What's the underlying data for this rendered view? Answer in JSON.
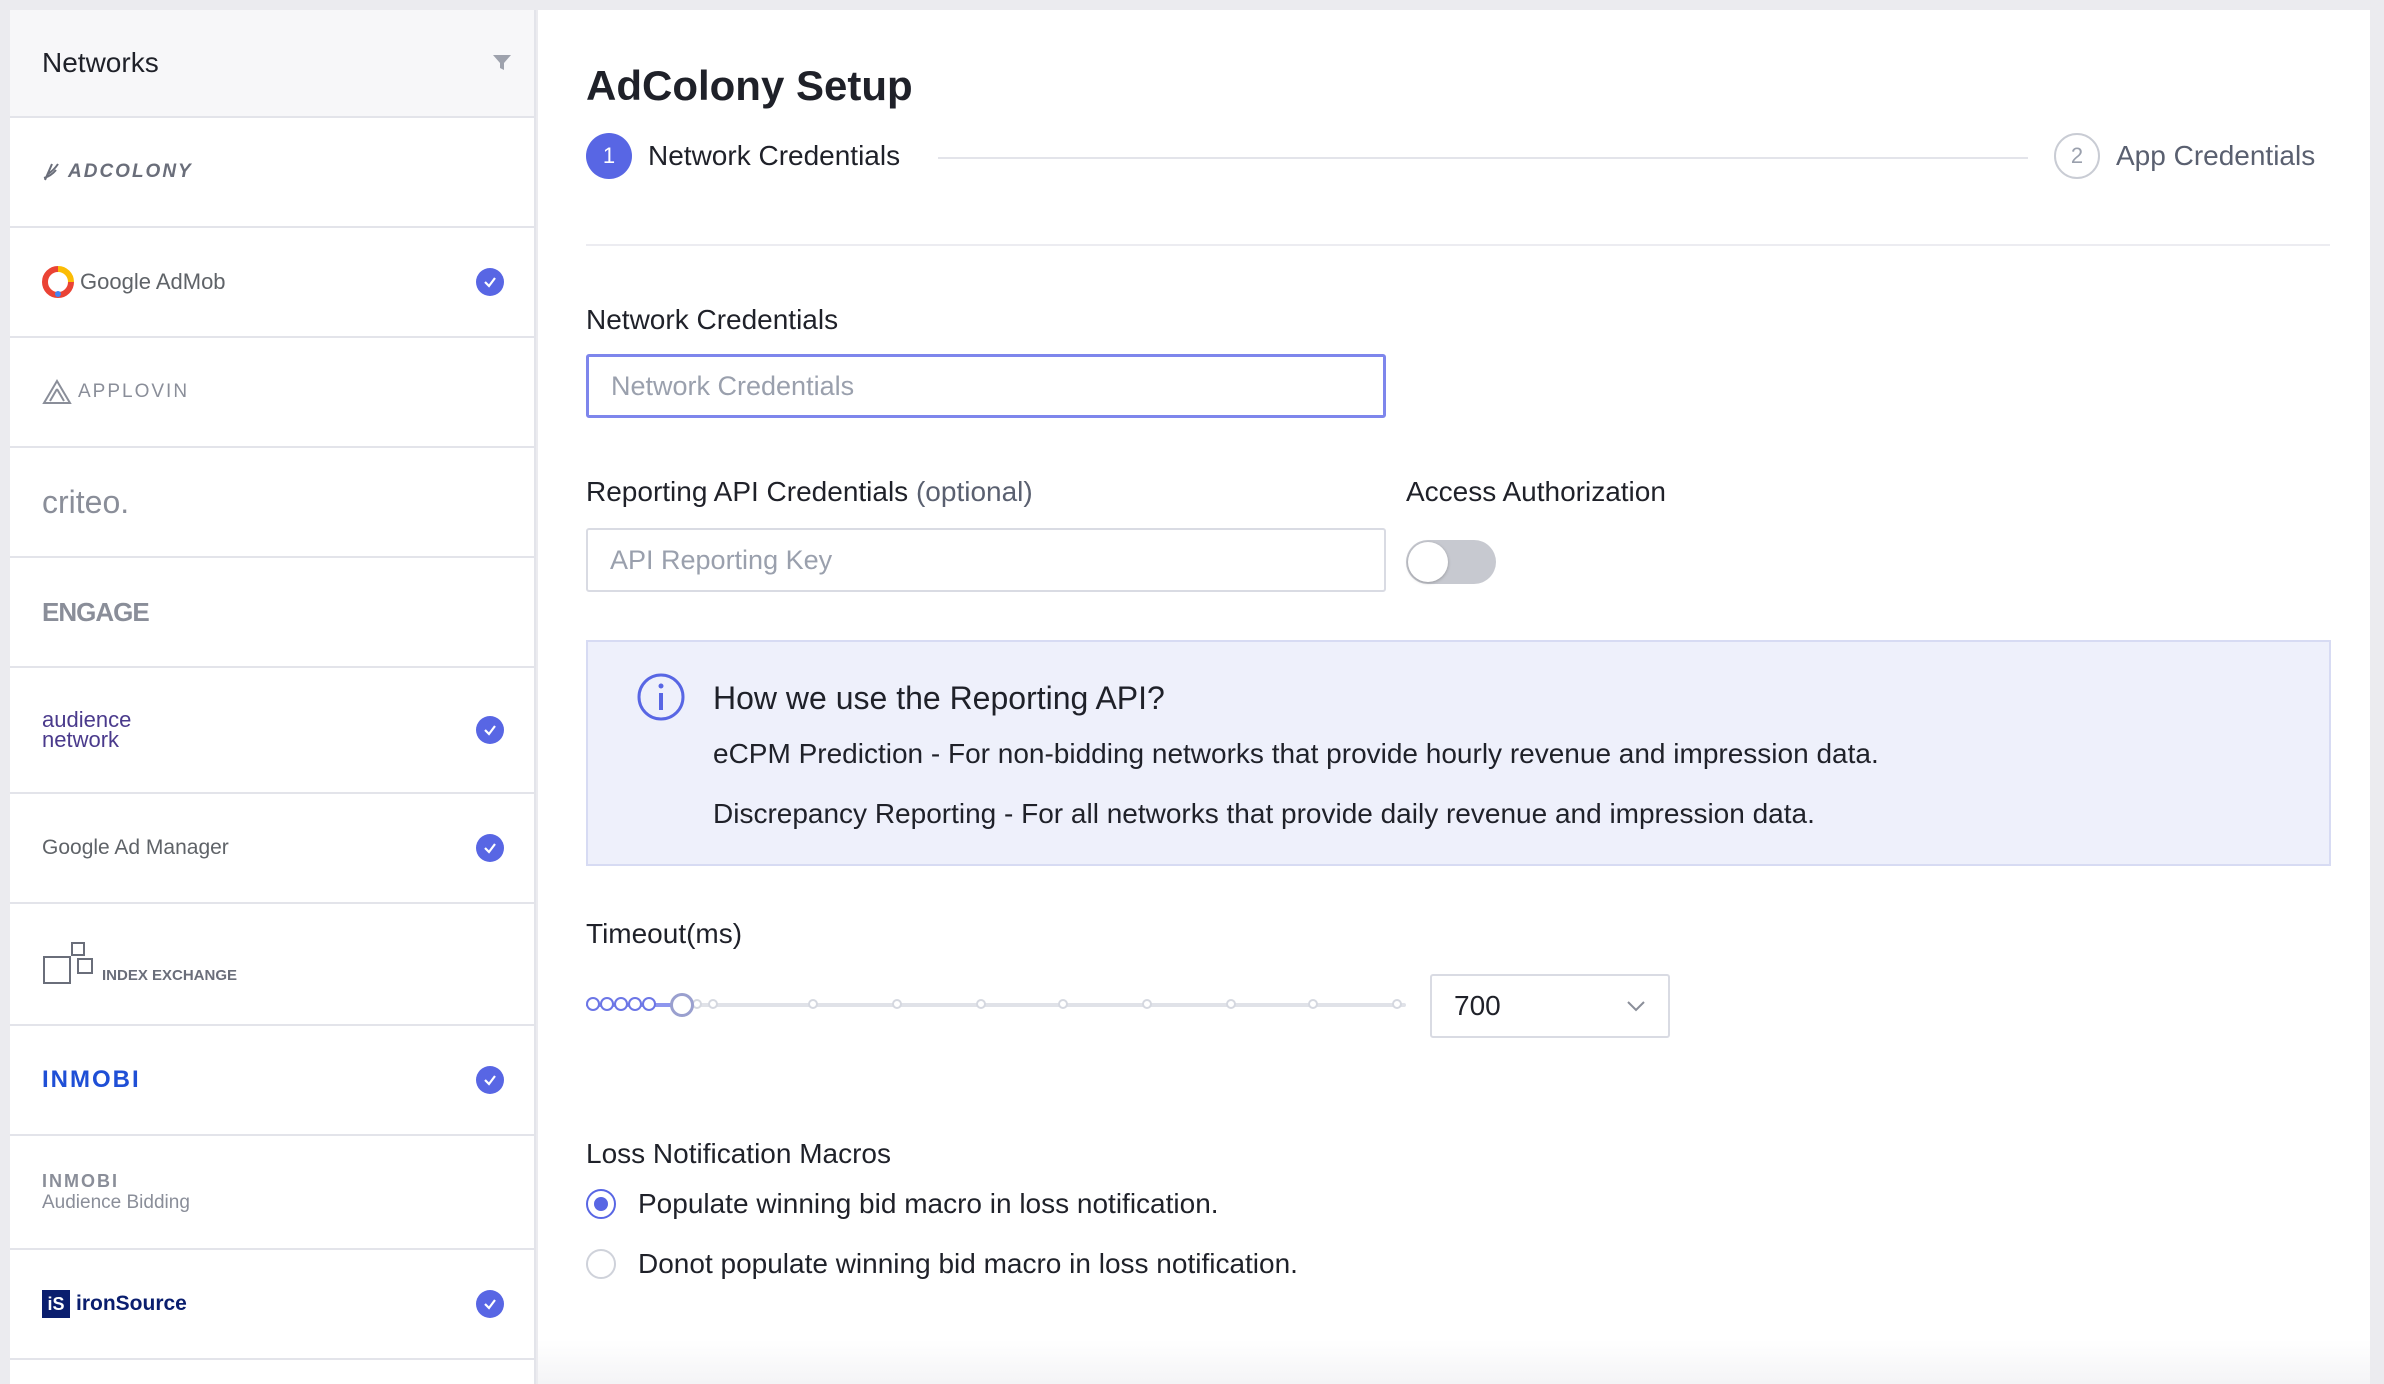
{
  "sidebar": {
    "title": "Networks",
    "items": [
      {
        "logo_text": "ADCOLONY",
        "selected": false
      },
      {
        "logo_text": "Google AdMob",
        "selected": true
      },
      {
        "logo_text": "APPLOVIN",
        "selected": false
      },
      {
        "logo_text": "criteo.",
        "selected": false
      },
      {
        "logo_text": "ENGAGE",
        "selected": false
      },
      {
        "logo_text": "audience network",
        "selected": true
      },
      {
        "logo_text": "Google Ad Manager",
        "selected": true
      },
      {
        "logo_text": "INDEX EXCHANGE",
        "selected": false
      },
      {
        "logo_text": "INMOBI",
        "selected": true
      },
      {
        "logo_text": "INMOBI",
        "logo_sub": "Audience Bidding",
        "selected": false
      },
      {
        "logo_text": "ironSource",
        "selected": true
      }
    ]
  },
  "main": {
    "title": "AdColony Setup",
    "steps": [
      {
        "number": "1",
        "label": "Network Credentials",
        "active": true
      },
      {
        "number": "2",
        "label": "App Credentials",
        "active": false
      }
    ],
    "network_credentials": {
      "label": "Network Credentials",
      "placeholder": "Network Credentials",
      "value": ""
    },
    "reporting": {
      "label": "Reporting API Credentials",
      "optional": "(optional)",
      "placeholder": "API Reporting Key"
    },
    "access": {
      "label": "Access Authorization",
      "enabled": false
    },
    "info": {
      "title": "How we use the Reporting API?",
      "line1": "eCPM Prediction - For non-bidding networks that provide hourly revenue and impression data.",
      "line2": "Discrepancy Reporting - For all networks that provide daily revenue and impression data."
    },
    "timeout": {
      "label": "Timeout(ms)",
      "value": "700"
    },
    "loss": {
      "label": "Loss Notification Macros",
      "options": [
        {
          "label": "Populate winning bid macro in loss notification.",
          "selected": true
        },
        {
          "label": "Donot populate winning bid macro in loss notification.",
          "selected": false
        }
      ]
    }
  },
  "colors": {
    "accent": "#5866e4",
    "info_bg": "#eef0fb"
  }
}
